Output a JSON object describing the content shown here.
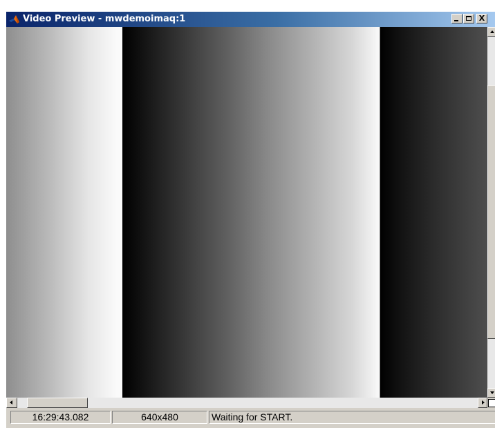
{
  "window": {
    "title": "Video Preview - mwdemoimaq:1",
    "app_icon": "matlab-logo-icon",
    "controls": {
      "minimize_icon": "minimize-icon",
      "maximize_icon": "maximize-icon",
      "close_label": "X"
    }
  },
  "preview": {
    "content": "grayscale-gradient-bars"
  },
  "statusbar": {
    "timestamp": "16:29:43.082",
    "resolution": "640x480",
    "message": "Waiting for START."
  },
  "colors": {
    "titlebar_start": "#0a246a",
    "titlebar_end": "#a6caf0",
    "chrome": "#d4d0c8"
  }
}
